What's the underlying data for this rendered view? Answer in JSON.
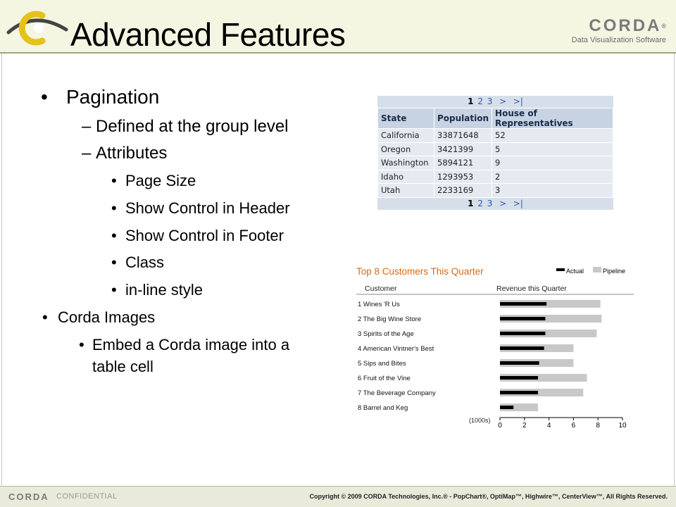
{
  "header": {
    "title": "Advanced Features",
    "brand_name": "CORDA",
    "brand_reg": "®",
    "brand_tagline": "Data Visualization Software"
  },
  "bullets": {
    "marker_l1": "•",
    "marker_l2": "–",
    "marker_l3": "•",
    "pagination": "Pagination",
    "defined": "Defined at the group level",
    "attributes": "Attributes",
    "page_size": "Page Size",
    "ctrl_header": "Show Control in Header",
    "ctrl_footer": "Show Control in Footer",
    "class": "Class",
    "inline_style": "in-line style",
    "corda_images": "Corda Images",
    "embed_1": "Embed a Corda image into a",
    "embed_2": "table cell"
  },
  "table": {
    "pager": {
      "pages": [
        "1",
        "2",
        "3"
      ],
      "next": ">",
      "last": ">|"
    },
    "columns": [
      "State",
      "Population",
      "House of Representatives"
    ],
    "rows": [
      [
        "California",
        "33871648",
        "52"
      ],
      [
        "Oregon",
        "3421399",
        "5"
      ],
      [
        "Washington",
        "5894121",
        "9"
      ],
      [
        "Idaho",
        "1293953",
        "2"
      ],
      [
        "Utah",
        "2233169",
        "3"
      ]
    ]
  },
  "chart_data": {
    "type": "bar",
    "orientation": "horizontal",
    "title": "Top 8 Customers This Quarter",
    "category_header": "Customer",
    "value_header": "Revenue this Quarter",
    "unit_label": "(1000s)",
    "categories": [
      "1 Wines 'R Us",
      "2 The Big Wine Store",
      "3 Spirits of the Age",
      "4 American Vintner's Best",
      "5 Sips and Bites",
      "6 Fruit of the Vine",
      "7 The Beverage Company",
      "8 Barrel and Keg"
    ],
    "series": [
      {
        "name": "Actual",
        "color": "#000000",
        "values": [
          3.8,
          3.7,
          3.7,
          3.6,
          3.2,
          3.1,
          3.1,
          1.1
        ]
      },
      {
        "name": "Pipeline",
        "color": "#c8c8c8",
        "values": [
          8.2,
          8.3,
          7.9,
          6.0,
          6.0,
          7.1,
          6.8,
          3.1
        ]
      }
    ],
    "xlim": [
      0,
      10
    ],
    "xticks": [
      "0",
      "2",
      "4",
      "6",
      "8",
      "10"
    ],
    "title_color": "#d96a12",
    "legend_position": "top-right"
  },
  "footer": {
    "brand": "CORDA",
    "confidential": "CONFIDENTIAL",
    "copyright": "Copyright © 2009 CORDA Technologies, Inc.® - PopChart®, OptiMap™, Highwire™, CenterView™, All Rights Reserved."
  }
}
